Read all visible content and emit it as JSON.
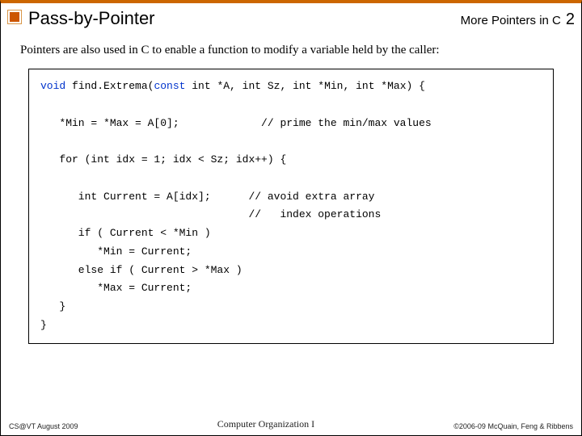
{
  "header": {
    "title": "Pass-by-Pointer",
    "right": "More Pointers in C",
    "page": "2"
  },
  "intro": "Pointers are also used in C to enable a function to modify a variable held by the caller:",
  "code": {
    "sig_pre": "void",
    "sig_name": " find.Extrema(",
    "sig_const": "const",
    "sig_rest": " int *A, int Sz, int *Min, int *Max) {",
    "l_prime": "   *Min = *Max = A[0];             // prime the min/max values",
    "l_for": "   for (int idx = 1; idx < Sz; idx++) {",
    "l_cur": "      int Current = A[idx];      // avoid extra array",
    "l_cur2": "                                 //   index operations",
    "l_if": "      if ( Current < *Min )",
    "l_min": "         *Min = Current;",
    "l_elif": "      else if ( Current > *Max )",
    "l_max": "         *Max = Current;",
    "l_closefor": "   }",
    "l_closefn": "}"
  },
  "footer": {
    "left": "CS@VT August 2009",
    "center": "Computer Organization I",
    "right": "©2006-09 McQuain, Feng & Ribbens"
  }
}
